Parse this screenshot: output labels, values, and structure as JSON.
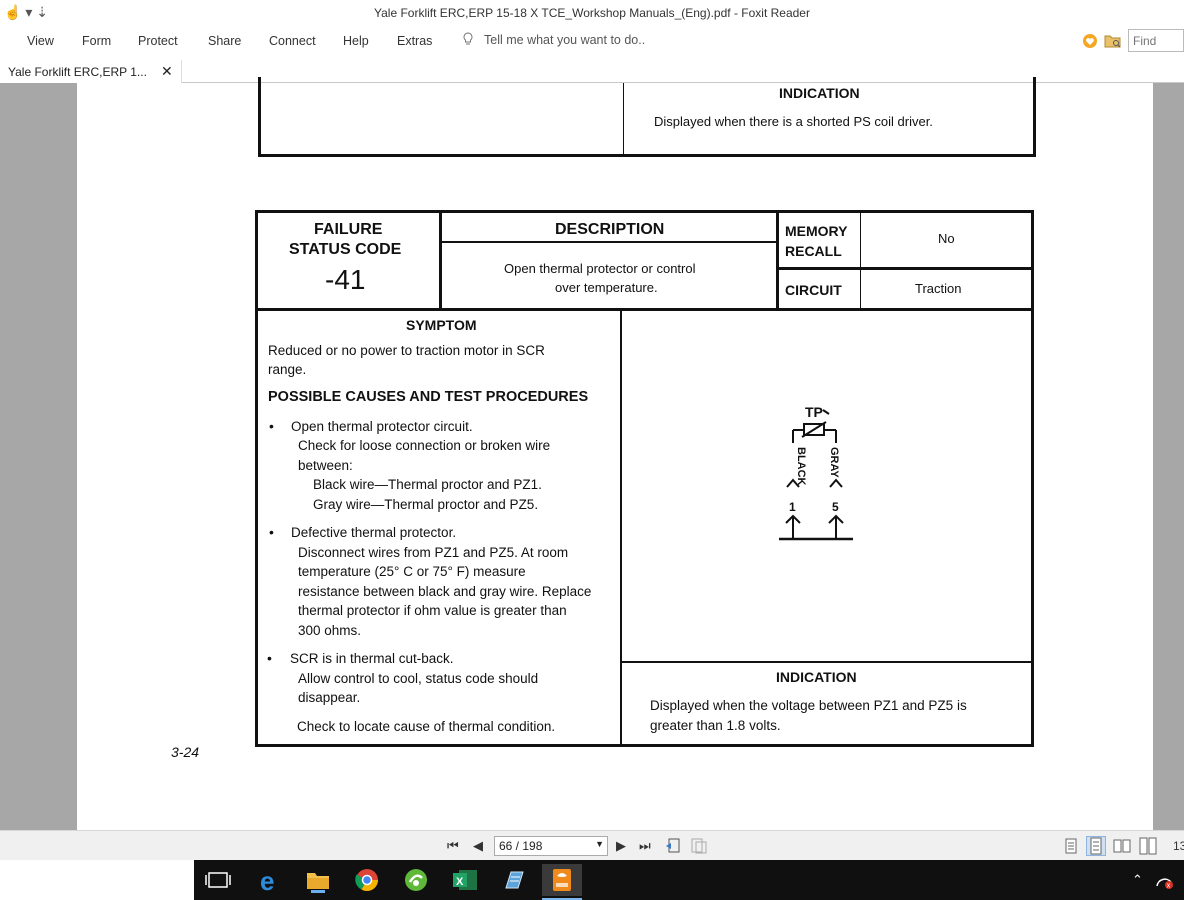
{
  "app": {
    "title": "Yale Forklift ERC,ERP 15-18 X TCE_Workshop Manuals_(Eng).pdf - Foxit Reader",
    "quick_access": "☝ ▾ ⇣"
  },
  "menu": {
    "items": [
      "View",
      "Form",
      "Protect",
      "Share",
      "Connect",
      "Help",
      "Extras"
    ],
    "tellme_placeholder": "Tell me what you want to do..",
    "find_placeholder": "Find"
  },
  "tab": {
    "label": "Yale Forklift ERC,ERP 1...",
    "close": "✕"
  },
  "document": {
    "top_block": {
      "indication_heading": "INDICATION",
      "indication_text": "Displayed when there is a shorted PS coil driver."
    },
    "main_block": {
      "failure_heading_line1": "FAILURE",
      "failure_heading_line2": "STATUS CODE",
      "code": "-41",
      "description_heading": "DESCRIPTION",
      "description_line1": "Open thermal protector or control",
      "description_line2": "over temperature.",
      "memory_recall_line1": "MEMORY",
      "memory_recall_line2": "RECALL",
      "memory_recall_value": "No",
      "circuit_label": "CIRCUIT",
      "circuit_value": "Traction",
      "symptom_heading": "SYMPTOM",
      "symptom_line1": "Reduced or no power to traction motor in SCR",
      "symptom_line2": "range.",
      "causes_heading": "POSSIBLE CAUSES AND TEST PROCEDURES",
      "cause1_title": "Open thermal protector circuit.",
      "cause1_l1": "Check for loose connection or broken wire",
      "cause1_l2": "between:",
      "cause1_l3": "Black wire—Thermal proctor and PZ1.",
      "cause1_l4": "Gray wire—Thermal proctor and PZ5.",
      "cause2_title": "Defective thermal protector.",
      "cause2_l1": "Disconnect wires from PZ1 and PZ5. At room",
      "cause2_l2": "temperature (25° C or 75° F) measure",
      "cause2_l3": "resistance between black and gray wire. Replace",
      "cause2_l4": "thermal protector if ohm value is greater than",
      "cause2_l5": "300 ohms.",
      "cause3_title": "SCR is in thermal cut-back.",
      "cause3_l1": "Allow control to cool, status code should",
      "cause3_l2": "disappear.",
      "cause3_l3": "Check to locate cause of thermal condition.",
      "indication_heading": "INDICATION",
      "indication_line1": "Displayed when the voltage between PZ1 and PZ5 is",
      "indication_line2": "greater than 1.8 volts.",
      "diagram": {
        "tp_label": "TP",
        "black_label": "BLACK",
        "gray_label": "GRAY",
        "pin1": "1",
        "pin5": "5"
      }
    },
    "page_label": "3-24"
  },
  "statusbar": {
    "page_display": "66 / 198",
    "zoom": "13"
  }
}
